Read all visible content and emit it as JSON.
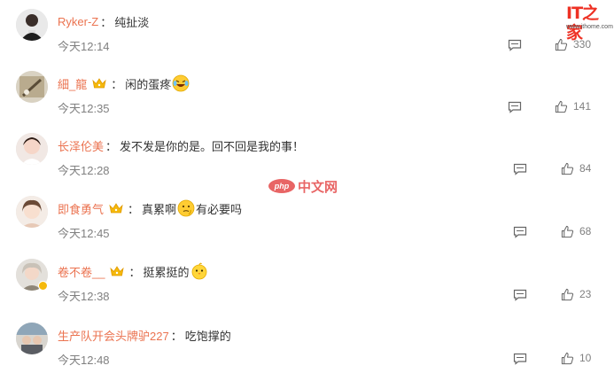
{
  "colors": {
    "username": "#eb7350",
    "text": "#333333",
    "meta": "#808080",
    "crown": "#f5b90b"
  },
  "watermark": {
    "site_title": "IT之家",
    "site_url": "www.ithome.com",
    "php_logo": "php",
    "php_text": "中文网"
  },
  "comments": [
    {
      "username": "Ryker-Z",
      "vip": false,
      "text": "纯扯淡",
      "text_after": "",
      "emoji": null,
      "time": "今天12:14",
      "likes": "330",
      "reply_icon": "reply-icon",
      "like_icon": "thumbs-up-icon"
    },
    {
      "username": "細_龍",
      "vip": true,
      "text": "闲的蛋疼",
      "text_after": "",
      "emoji": "laughing-tears-emoji",
      "time": "今天12:35",
      "likes": "141",
      "reply_icon": "reply-icon",
      "like_icon": "thumbs-up-icon"
    },
    {
      "username": "长泽伦美",
      "vip": false,
      "text": "发不发是你的是。回不回是我的事！",
      "text_after": "",
      "emoji": null,
      "time": "今天12:28",
      "likes": "84",
      "reply_icon": "reply-icon",
      "like_icon": "thumbs-up-icon"
    },
    {
      "username": "即食勇气",
      "vip": true,
      "text": "真累啊",
      "text_after": "有必要吗",
      "emoji": "thinking-emoji",
      "time": "今天12:45",
      "likes": "68",
      "reply_icon": "reply-icon",
      "like_icon": "thumbs-up-icon"
    },
    {
      "username": "卷不卷__",
      "vip": true,
      "text": "挺累挺的",
      "text_after": "",
      "emoji": "chick-emoji",
      "time": "今天12:38",
      "likes": "23",
      "reply_icon": "reply-icon",
      "like_icon": "thumbs-up-icon"
    },
    {
      "username": "生产队开会头牌驴227",
      "vip": false,
      "text": "吃饱撑的",
      "text_after": "",
      "emoji": null,
      "time": "今天12:48",
      "likes": "10",
      "reply_icon": "reply-icon",
      "like_icon": "thumbs-up-icon"
    }
  ]
}
